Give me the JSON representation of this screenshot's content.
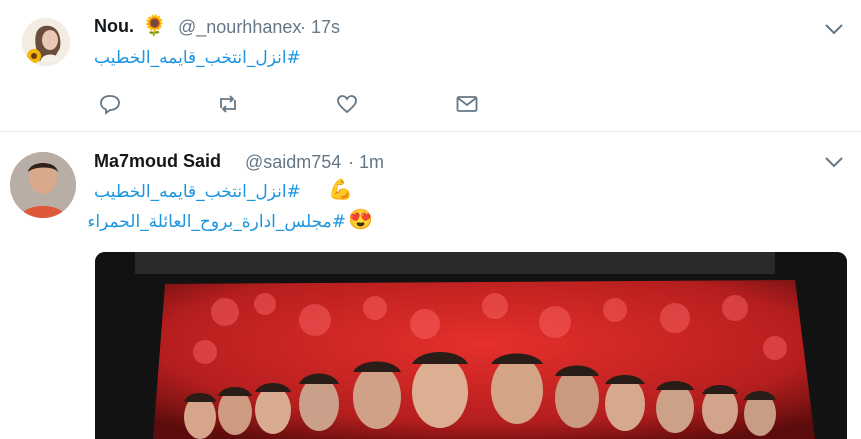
{
  "tweets": [
    {
      "name": "Nou.",
      "name_emoji": "🌻",
      "handle": "@_nourhhanex",
      "time": "· 17s",
      "lines": [
        "#انزل_انتخب_قايمه_الخطيب"
      ],
      "actions": [
        "reply-icon",
        "retweet-icon",
        "like-icon",
        "dm-icon"
      ]
    },
    {
      "name": "Ma7moud Said",
      "handle": "@saidm754",
      "time": "· 1m",
      "lines": [
        {
          "emoji": "💪",
          "text": "#انزل_انتخب_قايمه_الخطيب"
        },
        {
          "emoji": "😍",
          "text": "#مجلس_ادارة_بروح_العائلة_الحمراء"
        }
      ],
      "media": "photo"
    }
  ],
  "colors": {
    "link": "#1b95e0",
    "secondary": "#657786",
    "divider": "#e6ecf0"
  }
}
